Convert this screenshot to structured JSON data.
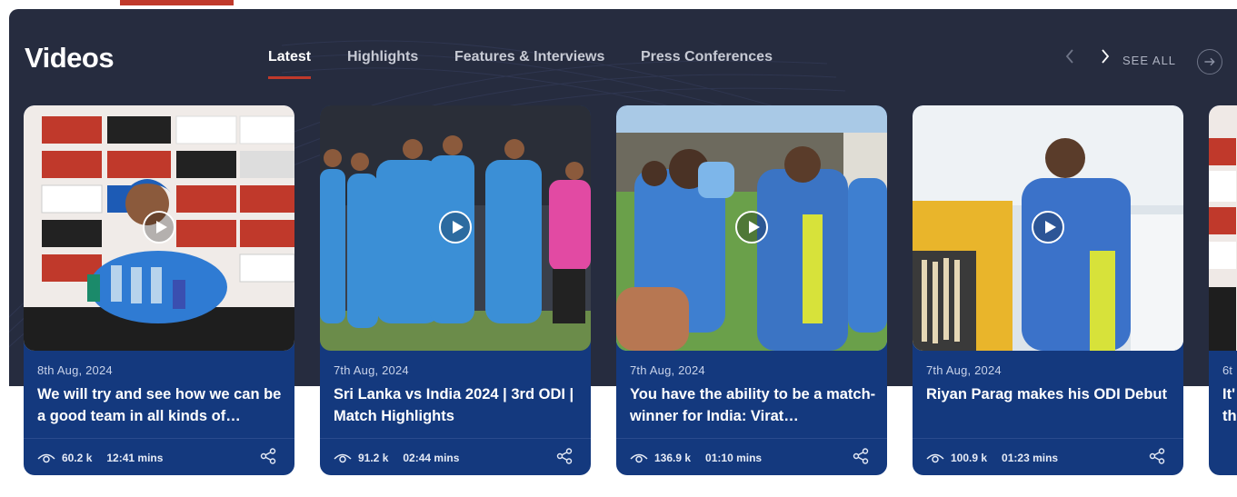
{
  "section": {
    "title": "Videos"
  },
  "tabs": [
    {
      "label": "Latest",
      "active": true
    },
    {
      "label": "Highlights",
      "active": false
    },
    {
      "label": "Features & Interviews",
      "active": false
    },
    {
      "label": "Press Conferences",
      "active": false
    }
  ],
  "nav": {
    "see_all_label": "SEE ALL",
    "prev_icon": "chevron-left-icon",
    "next_icon": "chevron-right-icon"
  },
  "colors": {
    "accent": "#c0392b",
    "panel_bg": "#262c3f",
    "card_bg": "#14397e"
  },
  "cards": [
    {
      "date": "8th Aug, 2024",
      "title": "We will try and see how we can be a good team in all kinds of…",
      "views": "60.2 k",
      "duration": "12:41 mins"
    },
    {
      "date": "7th Aug, 2024",
      "title": "Sri Lanka vs India 2024 | 3rd ODI | Match Highlights",
      "views": "91.2 k",
      "duration": "02:44 mins"
    },
    {
      "date": "7th Aug, 2024",
      "title": "You have the ability to be a match-winner for India: Virat…",
      "views": "136.9 k",
      "duration": "01:10 mins"
    },
    {
      "date": "7th Aug, 2024",
      "title": "Riyan Parag makes his ODI Debut",
      "views": "100.9 k",
      "duration": "01:23 mins"
    }
  ],
  "partial_card": {
    "date": "6t",
    "title": "It'\nth"
  }
}
